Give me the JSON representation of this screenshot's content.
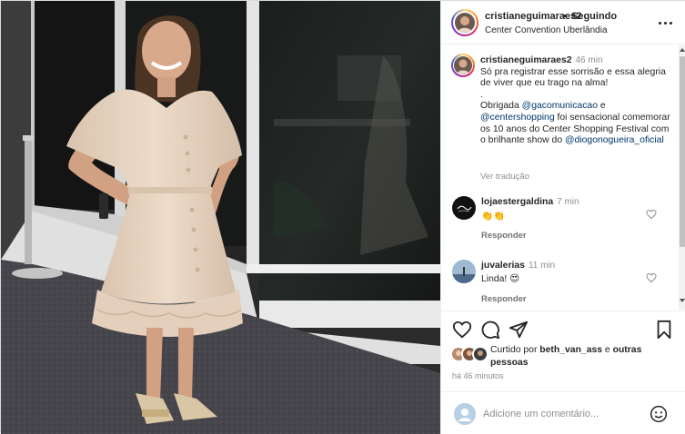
{
  "post": {
    "author": "cristianeguimaraes2",
    "separator": "•",
    "follow_status": "Seguindo",
    "location": "Center Convention Uberlândia",
    "caption": {
      "username": "cristianeguimaraes2",
      "time": "46 min",
      "line1": "Só pra registrar esse sorrisão e essa alegria de viver que eu trago na alma!",
      "line2": ".",
      "line3_prefix": "Obrigada ",
      "mention1": "@gacomunicacao",
      "line3_suffix": " e",
      "mention2": "@centershopping",
      "line4": " foi sensacional comemorar os 10 anos do Center Shopping Festival com o brilhante show do ",
      "mention3": "@diogonogueira_oficial",
      "see_translation": "Ver tradução"
    },
    "comments": [
      {
        "username": "lojaestergaldina",
        "time": "7 min",
        "text": "👏👏",
        "reply": "Responder"
      },
      {
        "username": "juvalerias",
        "time": "11 min",
        "text": "Linda! 😍",
        "reply": "Responder"
      }
    ],
    "likes": {
      "prefix": "Curtido por ",
      "user": "beth_van_ass",
      "middle": " e ",
      "others": "outras pessoas"
    },
    "time_ago": "há 46 minutos",
    "add_comment_placeholder": "Adicione um comentário...",
    "icons": {
      "like": "heart-icon",
      "comment": "comment-icon",
      "share": "send-icon",
      "save": "bookmark-icon",
      "more": "more-horizontal-icon",
      "emoji": "emoji-icon"
    },
    "colors": {
      "mention": "#00376b",
      "secondary_text": "#8e8e8e",
      "dress": "#e8d6c4"
    }
  }
}
